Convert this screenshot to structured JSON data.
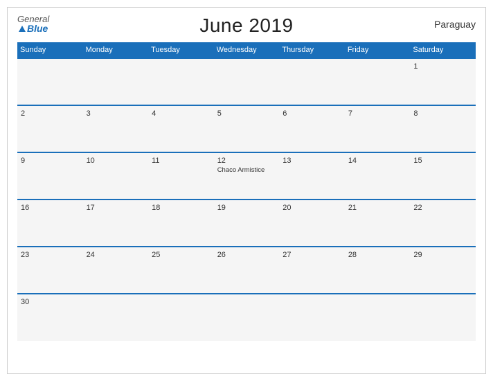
{
  "header": {
    "title": "June 2019",
    "country": "Paraguay",
    "logo_general": "General",
    "logo_blue": "Blue"
  },
  "days_of_week": [
    "Sunday",
    "Monday",
    "Tuesday",
    "Wednesday",
    "Thursday",
    "Friday",
    "Saturday"
  ],
  "weeks": [
    [
      {
        "day": "",
        "event": ""
      },
      {
        "day": "",
        "event": ""
      },
      {
        "day": "",
        "event": ""
      },
      {
        "day": "",
        "event": ""
      },
      {
        "day": "",
        "event": ""
      },
      {
        "day": "",
        "event": ""
      },
      {
        "day": "1",
        "event": ""
      }
    ],
    [
      {
        "day": "2",
        "event": ""
      },
      {
        "day": "3",
        "event": ""
      },
      {
        "day": "4",
        "event": ""
      },
      {
        "day": "5",
        "event": ""
      },
      {
        "day": "6",
        "event": ""
      },
      {
        "day": "7",
        "event": ""
      },
      {
        "day": "8",
        "event": ""
      }
    ],
    [
      {
        "day": "9",
        "event": ""
      },
      {
        "day": "10",
        "event": ""
      },
      {
        "day": "11",
        "event": ""
      },
      {
        "day": "12",
        "event": "Chaco Armistice"
      },
      {
        "day": "13",
        "event": ""
      },
      {
        "day": "14",
        "event": ""
      },
      {
        "day": "15",
        "event": ""
      }
    ],
    [
      {
        "day": "16",
        "event": ""
      },
      {
        "day": "17",
        "event": ""
      },
      {
        "day": "18",
        "event": ""
      },
      {
        "day": "19",
        "event": ""
      },
      {
        "day": "20",
        "event": ""
      },
      {
        "day": "21",
        "event": ""
      },
      {
        "day": "22",
        "event": ""
      }
    ],
    [
      {
        "day": "23",
        "event": ""
      },
      {
        "day": "24",
        "event": ""
      },
      {
        "day": "25",
        "event": ""
      },
      {
        "day": "26",
        "event": ""
      },
      {
        "day": "27",
        "event": ""
      },
      {
        "day": "28",
        "event": ""
      },
      {
        "day": "29",
        "event": ""
      }
    ],
    [
      {
        "day": "30",
        "event": ""
      },
      {
        "day": "",
        "event": ""
      },
      {
        "day": "",
        "event": ""
      },
      {
        "day": "",
        "event": ""
      },
      {
        "day": "",
        "event": ""
      },
      {
        "day": "",
        "event": ""
      },
      {
        "day": "",
        "event": ""
      }
    ]
  ]
}
